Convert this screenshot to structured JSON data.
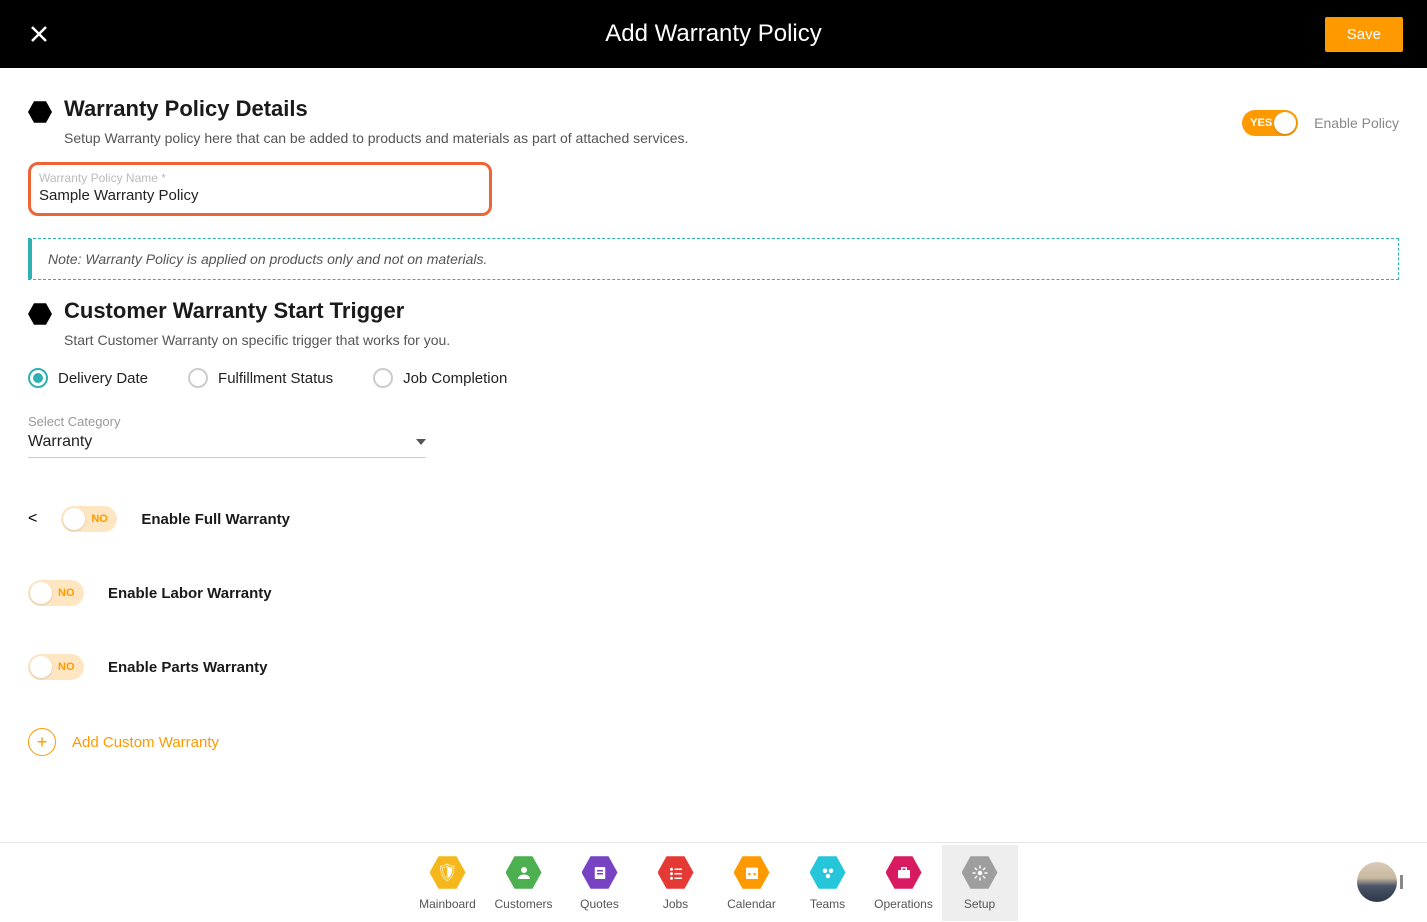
{
  "header": {
    "title": "Add Warranty Policy",
    "save": "Save"
  },
  "section1": {
    "title": "Warranty Policy Details",
    "sub": "Setup Warranty policy here that can be added to products and materials as part of attached services.",
    "enable_toggle": "YES",
    "enable_label": "Enable Policy",
    "input_label": "Warranty Policy Name *",
    "input_value": "Sample Warranty Policy",
    "note": "Note: Warranty Policy is applied on products only and not on materials."
  },
  "section2": {
    "title": "Customer Warranty Start Trigger",
    "sub": "Start Customer Warranty on specific trigger that works for you.",
    "radios": {
      "r1": "Delivery Date",
      "r2": "Fulfillment Status",
      "r3": "Job Completion"
    },
    "select_label": "Select Category",
    "select_value": "Warranty",
    "toggles": {
      "no": "NO",
      "t1": "Enable Full Warranty",
      "t2": "Enable Labor Warranty",
      "t3": "Enable Parts Warranty"
    },
    "add_custom": "Add Custom Warranty"
  },
  "nav": {
    "mainboard": "Mainboard",
    "customers": "Customers",
    "quotes": "Quotes",
    "jobs": "Jobs",
    "calendar": "Calendar",
    "teams": "Teams",
    "operations": "Operations",
    "setup": "Setup"
  },
  "colors": {
    "mainboard": "#f5b71b",
    "customers": "#4caf50",
    "quotes": "#7743c2",
    "jobs": "#e53935",
    "calendar": "#f90",
    "teams": "#26c6da",
    "operations": "#d81b60",
    "setup": "#9e9e9e"
  }
}
